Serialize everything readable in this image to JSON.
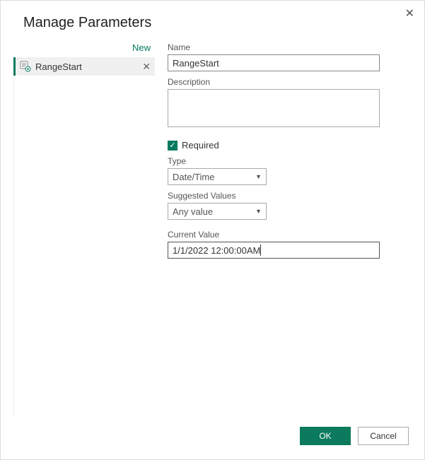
{
  "dialog": {
    "title": "Manage Parameters",
    "newLink": "New"
  },
  "sidebar": {
    "items": [
      {
        "label": "RangeStart"
      }
    ]
  },
  "form": {
    "nameLabel": "Name",
    "nameValue": "RangeStart",
    "descLabel": "Description",
    "descValue": "",
    "requiredLabel": "Required",
    "requiredChecked": true,
    "typeLabel": "Type",
    "typeValue": "Date/Time",
    "suggestedLabel": "Suggested Values",
    "suggestedValue": "Any value",
    "currentLabel": "Current Value",
    "currentValue": "1/1/2022 12:00:00AM"
  },
  "buttons": {
    "ok": "OK",
    "cancel": "Cancel"
  }
}
